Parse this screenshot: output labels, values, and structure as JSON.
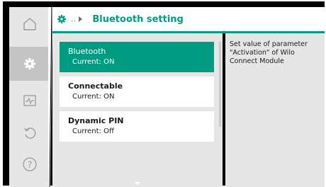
{
  "header": {
    "breadcrumb": "..",
    "title": "Bluetooth setting",
    "accent_color": "#009c82",
    "icon": "gear-icon"
  },
  "sidebar": {
    "items": [
      {
        "icon": "home-icon",
        "active": false
      },
      {
        "icon": "gear-icon",
        "active": true
      },
      {
        "icon": "diagnostics-icon",
        "active": false
      },
      {
        "icon": "undo-icon",
        "active": false
      },
      {
        "icon": "help-icon",
        "active": false
      }
    ]
  },
  "menu": {
    "items": [
      {
        "title": "Bluetooth",
        "value": "Current:  ON",
        "selected": true
      },
      {
        "title": "Connectable",
        "value": "Current:  ON",
        "selected": false
      },
      {
        "title": "Dynamic PIN",
        "value": "Current: Off",
        "selected": false
      }
    ]
  },
  "help": {
    "text": "Set value of parameter \"Activation\" of Wilo Connect Module"
  }
}
